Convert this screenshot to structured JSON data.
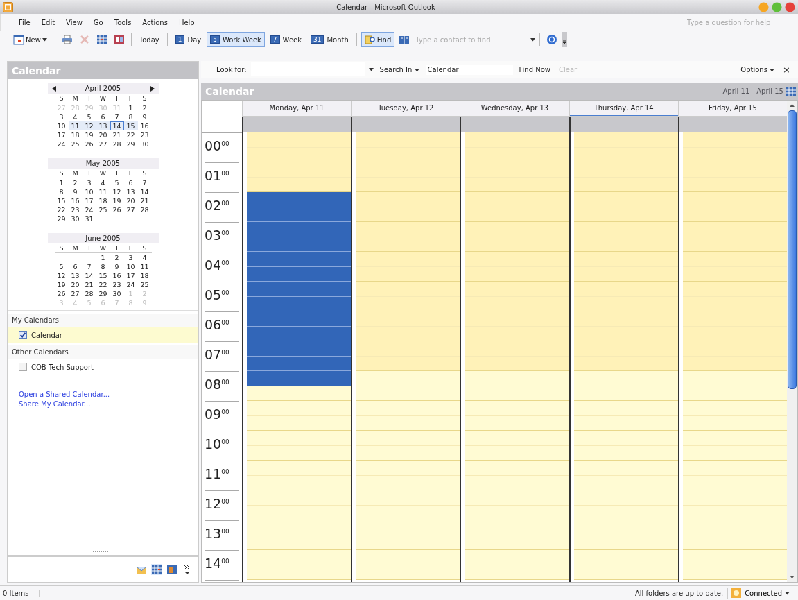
{
  "window": {
    "title": "Calendar - Microsoft Outlook"
  },
  "menu": [
    "File",
    "Edit",
    "View",
    "Go",
    "Tools",
    "Actions",
    "Help"
  ],
  "help_box": {
    "placeholder": "Type a question for help"
  },
  "toolbar": {
    "new": {
      "label": "New"
    },
    "icons": [
      {
        "disabled": false
      },
      {
        "disabled": true
      },
      {
        "disabled": false
      },
      {
        "disabled": false
      }
    ],
    "today": "Today",
    "views": [
      {
        "badge": "1",
        "label": "Day",
        "selected": false
      },
      {
        "badge": "5",
        "label": "Work Week",
        "selected": true
      },
      {
        "badge": "7",
        "label": "Week",
        "selected": false
      },
      {
        "badge": "31",
        "label": "Month",
        "selected": false
      }
    ],
    "find": {
      "label": "Find",
      "pressed": true
    },
    "contact": {
      "placeholder": "Type a contact to find"
    }
  },
  "nav": {
    "title": "Calendar",
    "months": [
      {
        "title": "April 2005",
        "arrows": true,
        "weekdays": [
          "S",
          "M",
          "T",
          "W",
          "T",
          "F",
          "S"
        ],
        "weeks": [
          [
            {
              "d": "27",
              "kind": "other"
            },
            {
              "d": "28",
              "kind": "other"
            },
            {
              "d": "29",
              "kind": "other"
            },
            {
              "d": "30",
              "kind": "other"
            },
            {
              "d": "31",
              "kind": "other"
            },
            {
              "d": "1",
              "kind": "normal"
            },
            {
              "d": "2",
              "kind": "normal"
            }
          ],
          [
            {
              "d": "3",
              "kind": "normal"
            },
            {
              "d": "4",
              "kind": "normal"
            },
            {
              "d": "5",
              "kind": "normal"
            },
            {
              "d": "6",
              "kind": "normal"
            },
            {
              "d": "7",
              "kind": "normal"
            },
            {
              "d": "8",
              "kind": "normal"
            },
            {
              "d": "9",
              "kind": "normal"
            }
          ],
          [
            {
              "d": "10",
              "kind": "normal"
            },
            {
              "d": "11",
              "kind": "range"
            },
            {
              "d": "12",
              "kind": "range"
            },
            {
              "d": "13",
              "kind": "range"
            },
            {
              "d": "14",
              "kind": "today"
            },
            {
              "d": "15",
              "kind": "range"
            },
            {
              "d": "16",
              "kind": "normal"
            }
          ],
          [
            {
              "d": "17",
              "kind": "normal"
            },
            {
              "d": "18",
              "kind": "normal"
            },
            {
              "d": "19",
              "kind": "normal"
            },
            {
              "d": "20",
              "kind": "normal"
            },
            {
              "d": "21",
              "kind": "normal"
            },
            {
              "d": "22",
              "kind": "normal"
            },
            {
              "d": "23",
              "kind": "normal"
            }
          ],
          [
            {
              "d": "24",
              "kind": "normal"
            },
            {
              "d": "25",
              "kind": "normal"
            },
            {
              "d": "26",
              "kind": "normal"
            },
            {
              "d": "27",
              "kind": "normal"
            },
            {
              "d": "28",
              "kind": "normal"
            },
            {
              "d": "29",
              "kind": "normal"
            },
            {
              "d": "30",
              "kind": "normal"
            }
          ]
        ]
      },
      {
        "title": "May 2005",
        "arrows": false,
        "weekdays": [
          "S",
          "M",
          "T",
          "W",
          "T",
          "F",
          "S"
        ],
        "weeks": [
          [
            {
              "d": "1",
              "kind": "normal"
            },
            {
              "d": "2",
              "kind": "normal"
            },
            {
              "d": "3",
              "kind": "normal"
            },
            {
              "d": "4",
              "kind": "normal"
            },
            {
              "d": "5",
              "kind": "normal"
            },
            {
              "d": "6",
              "kind": "normal"
            },
            {
              "d": "7",
              "kind": "normal"
            }
          ],
          [
            {
              "d": "8",
              "kind": "normal"
            },
            {
              "d": "9",
              "kind": "normal"
            },
            {
              "d": "10",
              "kind": "normal"
            },
            {
              "d": "11",
              "kind": "normal"
            },
            {
              "d": "12",
              "kind": "normal"
            },
            {
              "d": "13",
              "kind": "normal"
            },
            {
              "d": "14",
              "kind": "normal"
            }
          ],
          [
            {
              "d": "15",
              "kind": "normal"
            },
            {
              "d": "16",
              "kind": "normal"
            },
            {
              "d": "17",
              "kind": "normal"
            },
            {
              "d": "18",
              "kind": "normal"
            },
            {
              "d": "19",
              "kind": "normal"
            },
            {
              "d": "20",
              "kind": "normal"
            },
            {
              "d": "21",
              "kind": "normal"
            }
          ],
          [
            {
              "d": "22",
              "kind": "normal"
            },
            {
              "d": "23",
              "kind": "normal"
            },
            {
              "d": "24",
              "kind": "normal"
            },
            {
              "d": "25",
              "kind": "normal"
            },
            {
              "d": "26",
              "kind": "normal"
            },
            {
              "d": "27",
              "kind": "normal"
            },
            {
              "d": "28",
              "kind": "normal"
            }
          ],
          [
            {
              "d": "29",
              "kind": "normal"
            },
            {
              "d": "30",
              "kind": "normal"
            },
            {
              "d": "31",
              "kind": "normal"
            }
          ]
        ]
      },
      {
        "title": "June 2005",
        "arrows": false,
        "weekdays": [
          "S",
          "M",
          "T",
          "W",
          "T",
          "F",
          "S"
        ],
        "weeks": [
          [
            {
              "d": "1",
              "kind": "normal"
            },
            {
              "d": "2",
              "kind": "normal"
            },
            {
              "d": "3",
              "kind": "normal"
            },
            {
              "d": "4",
              "kind": "normal"
            }
          ],
          [
            {
              "d": "5",
              "kind": "normal"
            },
            {
              "d": "6",
              "kind": "normal"
            },
            {
              "d": "7",
              "kind": "normal"
            },
            {
              "d": "8",
              "kind": "normal"
            },
            {
              "d": "9",
              "kind": "normal"
            },
            {
              "d": "10",
              "kind": "normal"
            },
            {
              "d": "11",
              "kind": "normal"
            }
          ],
          [
            {
              "d": "12",
              "kind": "normal"
            },
            {
              "d": "13",
              "kind": "normal"
            },
            {
              "d": "14",
              "kind": "normal"
            },
            {
              "d": "15",
              "kind": "normal"
            },
            {
              "d": "16",
              "kind": "normal"
            },
            {
              "d": "17",
              "kind": "normal"
            },
            {
              "d": "18",
              "kind": "normal"
            }
          ],
          [
            {
              "d": "19",
              "kind": "normal"
            },
            {
              "d": "20",
              "kind": "normal"
            },
            {
              "d": "21",
              "kind": "normal"
            },
            {
              "d": "22",
              "kind": "normal"
            },
            {
              "d": "23",
              "kind": "normal"
            },
            {
              "d": "24",
              "kind": "normal"
            },
            {
              "d": "25",
              "kind": "normal"
            }
          ],
          [
            {
              "d": "26",
              "kind": "normal"
            },
            {
              "d": "27",
              "kind": "normal"
            },
            {
              "d": "28",
              "kind": "normal"
            },
            {
              "d": "29",
              "kind": "normal"
            },
            {
              "d": "30",
              "kind": "normal"
            },
            {
              "d": "1",
              "kind": "other"
            },
            {
              "d": "2",
              "kind": "other"
            }
          ],
          [
            {
              "d": "3",
              "kind": "other"
            },
            {
              "d": "4",
              "kind": "other"
            },
            {
              "d": "5",
              "kind": "other"
            },
            {
              "d": "6",
              "kind": "other"
            },
            {
              "d": "7",
              "kind": "other"
            },
            {
              "d": "8",
              "kind": "other"
            },
            {
              "d": "9",
              "kind": "other"
            }
          ]
        ]
      }
    ],
    "groups": [
      {
        "title": "My Calendars",
        "items": [
          {
            "label": "Calendar",
            "checked": true,
            "selected": true
          }
        ]
      },
      {
        "title": "Other Calendars",
        "items": [
          {
            "label": "COB Tech Support",
            "checked": false,
            "selected": false
          }
        ]
      }
    ],
    "links": [
      "Open a Shared Calendar...",
      "Share My Calendar..."
    ]
  },
  "search": {
    "look_for": "Look for:",
    "search_in": "Search In",
    "scope": "Calendar",
    "find_now": "Find Now",
    "clear": {
      "label": "Clear",
      "disabled": true
    },
    "options": "Options",
    "close": "×"
  },
  "calendar": {
    "title": "Calendar",
    "range": "April 11 - April 15",
    "days": [
      {
        "label": "Monday, Apr 11",
        "selected": true,
        "today": false
      },
      {
        "label": "Tuesday, Apr 12",
        "selected": false,
        "today": false
      },
      {
        "label": "Wednesday, Apr 13",
        "selected": false,
        "today": false
      },
      {
        "label": "Thursday, Apr 14",
        "selected": false,
        "today": true
      },
      {
        "label": "Friday, Apr 15",
        "selected": false,
        "today": false
      }
    ],
    "hours": [
      {
        "label": "00$^{00}$",
        "kind": "off",
        "halves": [
          {
            "selected": false
          },
          {
            "selected": false
          }
        ]
      },
      {
        "label": "01$^{00}$",
        "kind": "off",
        "halves": [
          {
            "selected": false
          },
          {
            "selected": false
          }
        ]
      },
      {
        "label": "02$^{00}$",
        "kind": "off",
        "halves": [
          {
            "selected": true
          },
          {
            "selected": true
          }
        ]
      },
      {
        "label": "03$^{00}$",
        "kind": "off",
        "halves": [
          {
            "selected": true
          },
          {
            "selected": true
          }
        ]
      },
      {
        "label": "04$^{00}$",
        "kind": "off",
        "halves": [
          {
            "selected": true
          },
          {
            "selected": true
          }
        ]
      },
      {
        "label": "05$^{00}$",
        "kind": "off",
        "halves": [
          {
            "selected": true
          },
          {
            "selected": true
          }
        ]
      },
      {
        "label": "06$^{00}$",
        "kind": "off",
        "halves": [
          {
            "selected": true
          },
          {
            "selected": true
          }
        ]
      },
      {
        "label": "07$^{00}$",
        "kind": "off",
        "halves": [
          {
            "selected": true
          },
          {
            "selected": true
          }
        ]
      },
      {
        "label": "08$^{00}$",
        "kind": "work",
        "halves": [
          {
            "selected": true
          },
          {
            "selected": false
          }
        ]
      },
      {
        "label": "09$^{00}$",
        "kind": "work",
        "halves": [
          {
            "selected": false
          },
          {
            "selected": false
          }
        ]
      },
      {
        "label": "10$^{00}$",
        "kind": "work",
        "halves": [
          {
            "selected": false
          },
          {
            "selected": false
          }
        ]
      },
      {
        "label": "11$^{00}$",
        "kind": "work",
        "halves": [
          {
            "selected": false
          },
          {
            "selected": false
          }
        ]
      },
      {
        "label": "12$^{00}$",
        "kind": "work",
        "halves": [
          {
            "selected": false
          },
          {
            "selected": false
          }
        ]
      },
      {
        "label": "13$^{00}$",
        "kind": "work",
        "halves": [
          {
            "selected": false
          },
          {
            "selected": false
          }
        ]
      },
      {
        "label": "14$^{00}$",
        "kind": "work",
        "halves": [
          {
            "selected": false
          },
          {
            "selected": false
          }
        ]
      }
    ]
  },
  "status_bar": {
    "items": "0 Items",
    "sync": "All folders are up to date.",
    "connection": "Connected"
  }
}
